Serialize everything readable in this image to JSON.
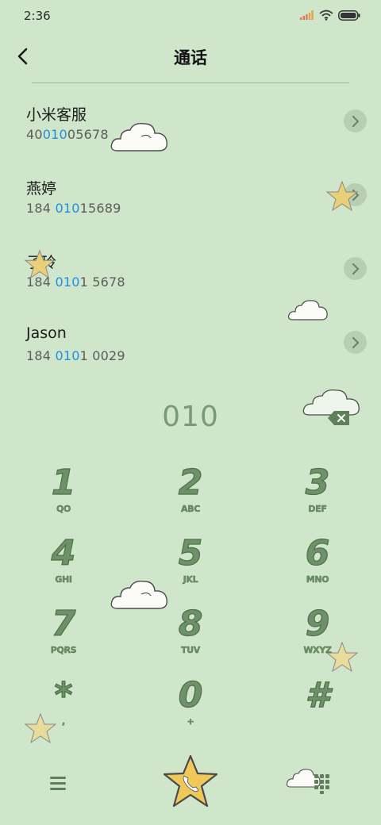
{
  "status": {
    "time": "2:36",
    "signal_icon": "signal-icon",
    "wifi_icon": "wifi-icon",
    "battery_icon": "battery-icon"
  },
  "header": {
    "title": "通话",
    "back_icon": "back-arrow-icon"
  },
  "contacts": [
    {
      "name": "小米客服",
      "number_pre": "40",
      "number_hl": "010",
      "number_post": "05678"
    },
    {
      "name": "燕婷",
      "number_pre": "184 ",
      "number_hl": "010",
      "number_post": "15689"
    },
    {
      "name": "子玲",
      "number_pre": "184 ",
      "number_hl": "010",
      "number_post": "1 5678"
    },
    {
      "name": "Jason",
      "number_pre": "184 ",
      "number_hl": "010",
      "number_post": "1 0029"
    }
  ],
  "dial": {
    "value": "010"
  },
  "keypad": [
    {
      "digit": "1",
      "letters": "QO"
    },
    {
      "digit": "2",
      "letters": "ABC"
    },
    {
      "digit": "3",
      "letters": "DEF"
    },
    {
      "digit": "4",
      "letters": "GHI"
    },
    {
      "digit": "5",
      "letters": "JKL"
    },
    {
      "digit": "6",
      "letters": "MNO"
    },
    {
      "digit": "7",
      "letters": "PQRS"
    },
    {
      "digit": "8",
      "letters": "TUV"
    },
    {
      "digit": "9",
      "letters": "WXYZ"
    },
    {
      "digit": "*",
      "letters": ","
    },
    {
      "digit": "0",
      "letters": "+"
    },
    {
      "digit": "#",
      "letters": ""
    }
  ],
  "colors": {
    "background": "#cfe6cb",
    "highlight": "#1f8fe0",
    "key_green": "#6f9169",
    "star": "#f0c85a"
  }
}
